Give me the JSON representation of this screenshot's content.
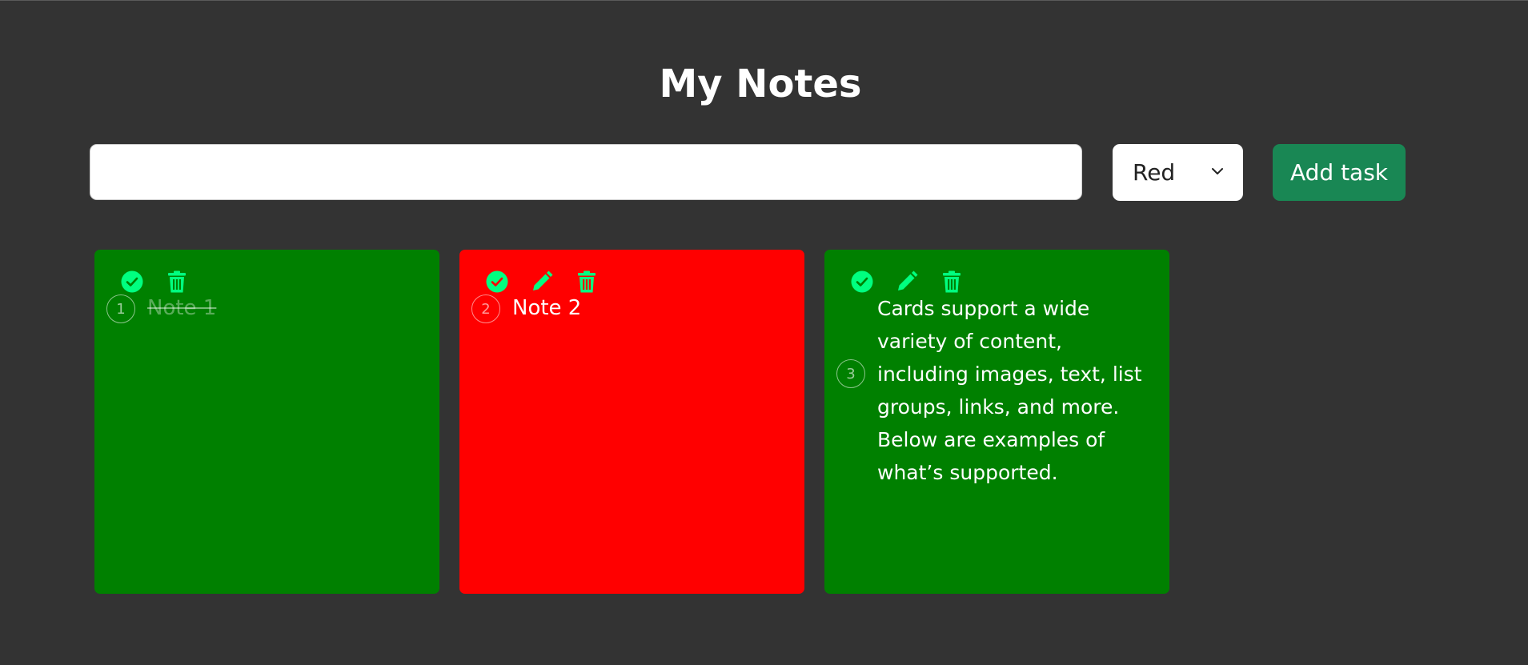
{
  "header": {
    "title": "My Notes"
  },
  "form": {
    "input_value": "",
    "color_selected": "Red",
    "add_label": "Add task"
  },
  "colors": {
    "background": "#333333",
    "green_card": "#008000",
    "red_card": "#ff0000",
    "accent_icon": "#00ff80",
    "add_button": "#198754"
  },
  "notes": [
    {
      "number": "1",
      "text": "Note 1",
      "color": "green",
      "completed": true,
      "icons": [
        "check-circle-icon",
        "trash-icon"
      ]
    },
    {
      "number": "2",
      "text": "Note 2",
      "color": "red",
      "completed": false,
      "icons": [
        "check-circle-icon",
        "pencil-icon",
        "trash-icon"
      ]
    },
    {
      "number": "3",
      "text": "Cards support a wide variety of content, including images, text, list groups, links, and more. Below are examples of what’s supported.",
      "color": "green",
      "completed": false,
      "icons": [
        "check-circle-icon",
        "pencil-icon",
        "trash-icon"
      ]
    }
  ]
}
